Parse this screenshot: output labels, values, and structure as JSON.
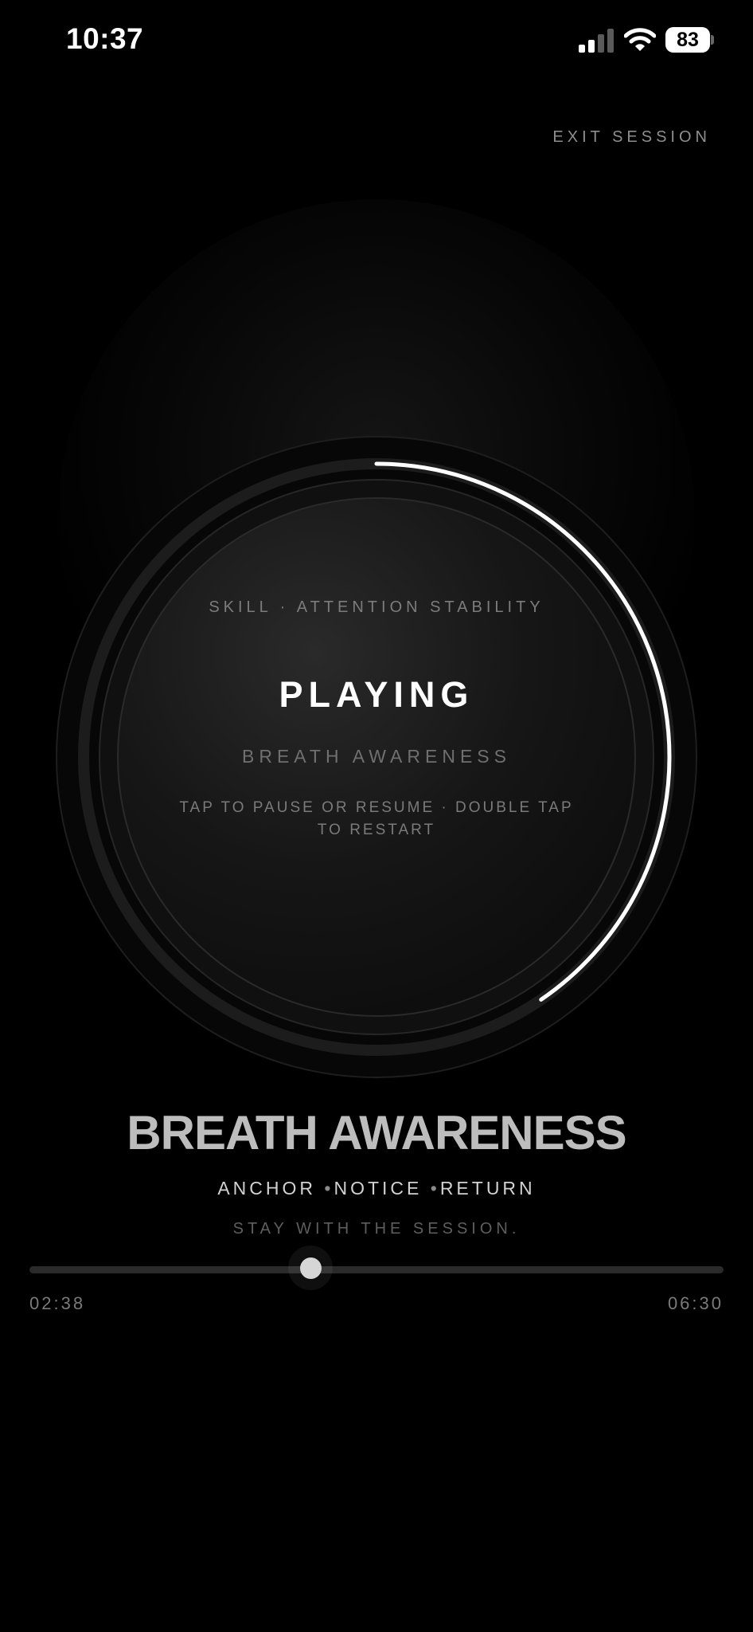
{
  "status_bar": {
    "time": "10:37",
    "battery_level": "83",
    "icons": [
      "cellular-signal-icon",
      "wifi-icon",
      "battery-icon"
    ]
  },
  "header": {
    "exit_label": "EXIT SESSION"
  },
  "player": {
    "skill_label": "SKILL · ATTENTION STABILITY",
    "state": "PLAYING",
    "session_name": "BREATH AWARENESS",
    "hint": "TAP TO PAUSE OR RESUME · DOUBLE TAP TO RESTART",
    "ring_progress": 0.405
  },
  "session": {
    "title": "BREATH AWARENESS",
    "steps": [
      "ANCHOR",
      "NOTICE",
      "RETURN"
    ],
    "tagline": "STAY WITH THE SESSION."
  },
  "progress": {
    "elapsed": "02:38",
    "total": "06:30",
    "fraction": 0.405
  },
  "colors": {
    "background": "#000000",
    "ring": "#ffffff",
    "muted_text": "#7a7a7a",
    "title_text": "#bdbdbd"
  }
}
